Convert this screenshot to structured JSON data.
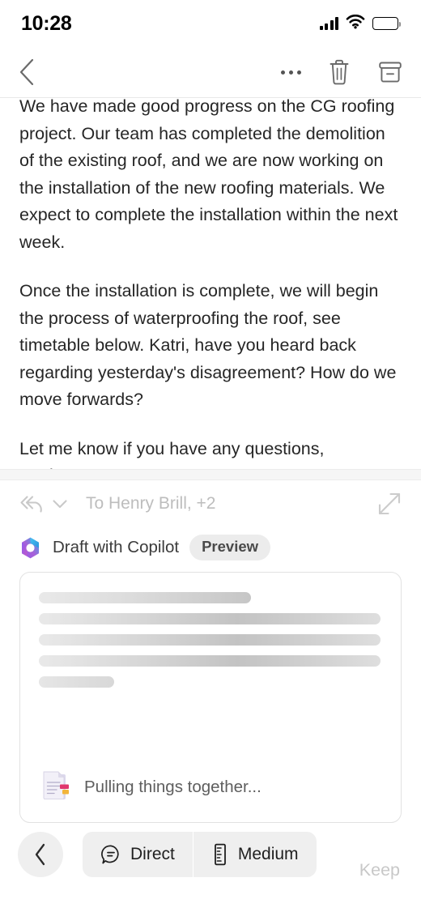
{
  "status_bar": {
    "time": "10:28",
    "signal_icon": "signal-bars-icon",
    "wifi_icon": "wifi-icon",
    "battery_icon": "battery-full-icon"
  },
  "nav_bar": {
    "back_icon": "chevron-left-icon",
    "more_icon": "ellipsis-icon",
    "delete_icon": "trash-icon",
    "archive_icon": "archive-icon"
  },
  "email": {
    "paragraphs": [
      "We have made good progress on the CG roofing project. Our team has completed the demolition of the existing roof, and we are now working on the installation of the new roofing materials. We expect to complete the installation within the next week.",
      "Once the installation is complete, we will begin the process of waterproofing the roof, see timetable below. Katri, have you heard back regarding yesterday's disagreement? How do we move forwards?",
      "Let me know if you have any questions,\nKevin S"
    ],
    "quoted_text_toggle": "..."
  },
  "compose": {
    "reply_all_icon": "reply-all-icon",
    "reply_mode_chevron_icon": "chevron-down-icon",
    "recipients": "To Henry Brill, +2",
    "expand_icon": "expand-diagonal-icon",
    "copilot_logo_icon": "copilot-logo-icon",
    "copilot_label": "Draft with Copilot",
    "preview_badge": "Preview",
    "accent_colors": {
      "copilot_purple": "#8b5cf0",
      "copilot_magenta": "#b45ad0",
      "copilot_blue": "#29a6e8",
      "copilot_cyan": "#41c3f0"
    }
  },
  "draft_card": {
    "skeleton_line_widths": [
      62,
      100,
      100,
      100,
      22
    ],
    "doc_icon": "document-generating-icon",
    "status_text": "Pulling things together..."
  },
  "bottom_bar": {
    "back_icon": "chevron-left-icon",
    "tone": {
      "icon": "chat-bubble-lines-icon",
      "label": "Direct"
    },
    "length": {
      "icon": "ruler-icon",
      "label": "Medium"
    },
    "keep_label": "Keep"
  }
}
